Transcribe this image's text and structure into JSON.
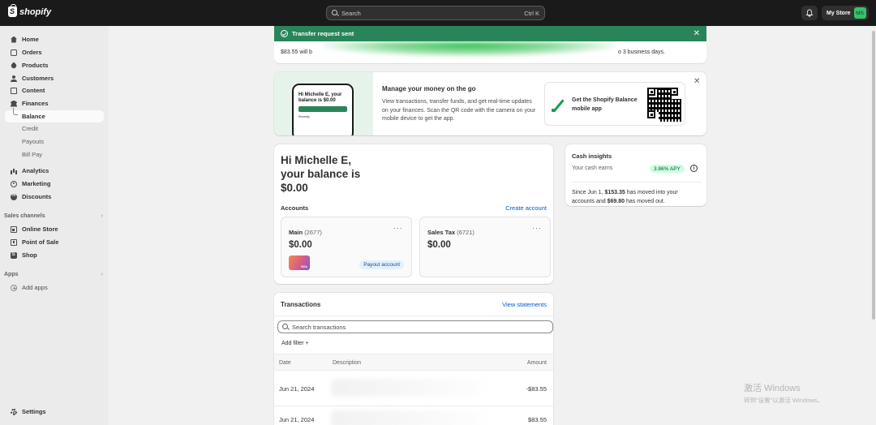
{
  "topbar": {
    "brand": "shopify",
    "search_placeholder": "Search",
    "search_shortcut": "Ctrl K",
    "store_name": "My Store",
    "avatar_initials": "MS"
  },
  "sidebar": {
    "items": [
      {
        "label": "Home",
        "icon": "home-icon"
      },
      {
        "label": "Orders",
        "icon": "inbox-icon"
      },
      {
        "label": "Products",
        "icon": "tag-icon"
      },
      {
        "label": "Customers",
        "icon": "person-icon"
      },
      {
        "label": "Content",
        "icon": "document-icon"
      },
      {
        "label": "Finances",
        "icon": "bank-icon"
      },
      {
        "label": "Balance",
        "icon": "",
        "active": true
      },
      {
        "label": "Credit"
      },
      {
        "label": "Payouts"
      },
      {
        "label": "Bill Pay"
      },
      {
        "label": "Analytics",
        "icon": "bar-chart-icon"
      },
      {
        "label": "Marketing",
        "icon": "target-icon"
      },
      {
        "label": "Discounts",
        "icon": "discount-icon"
      }
    ],
    "sales_channels_title": "Sales channels",
    "channels": [
      {
        "label": "Online Store",
        "icon": "store-icon"
      },
      {
        "label": "Point of Sale",
        "icon": "pos-icon"
      },
      {
        "label": "Shop",
        "icon": "shop-icon"
      }
    ],
    "apps_title": "Apps",
    "add_apps": "Add apps",
    "settings": "Settings"
  },
  "toast": {
    "title": "Transfer request sent",
    "message_start": "$83.55 will b",
    "message_end": "o 3 business days."
  },
  "promo": {
    "phone_greeting": "Hi Michelle E, your balance is $0.00",
    "phone_small": "Recently",
    "heading": "Manage your money on the go",
    "body": "View transactions, transfer funds, and get real-time updates on your finances. Scan the QR code with the camera on your mobile device to get the app.",
    "app_label": "Get the Shopify Balance mobile app"
  },
  "balance": {
    "greeting_line1": "Hi Michelle E,",
    "greeting_line2": "your balance is",
    "greeting_amount": "$0.00",
    "accounts_title": "Accounts",
    "create_account": "Create account",
    "accounts": [
      {
        "name": "Main",
        "number": "(2677)",
        "amount": "$0.00",
        "badge": "Payout account"
      },
      {
        "name": "Sales Tax",
        "number": "(6721)",
        "amount": "$0.00"
      }
    ]
  },
  "cash_insights": {
    "title": "Cash insights",
    "earns_label": "Your cash earns",
    "apy": "3.86% APY",
    "desc_prefix": "Since Jun 1, ",
    "moved_in": "$153.35",
    "desc_mid": " has moved into your accounts and ",
    "moved_out": "$69.80",
    "desc_suffix": " has moved out."
  },
  "transactions": {
    "title": "Transactions",
    "view_statements": "View statements",
    "search_placeholder": "Search transactions",
    "add_filter": "Add filter +",
    "columns": {
      "date": "Date",
      "description": "Description",
      "amount": "Amount"
    },
    "rows": [
      {
        "date": "Jun 21, 2024",
        "amount": "-$83.55"
      },
      {
        "date": "Jun 21, 2024",
        "amount": "$83.55"
      }
    ]
  },
  "watermark": {
    "line1": "激活 Windows",
    "line2": "转到\"设置\"以激活 Windows。"
  },
  "colors": {
    "topbar_bg": "#1a1a1a",
    "toast_green": "#29845a",
    "link_blue": "#005bd3",
    "apy_bg": "#cdfee1"
  }
}
